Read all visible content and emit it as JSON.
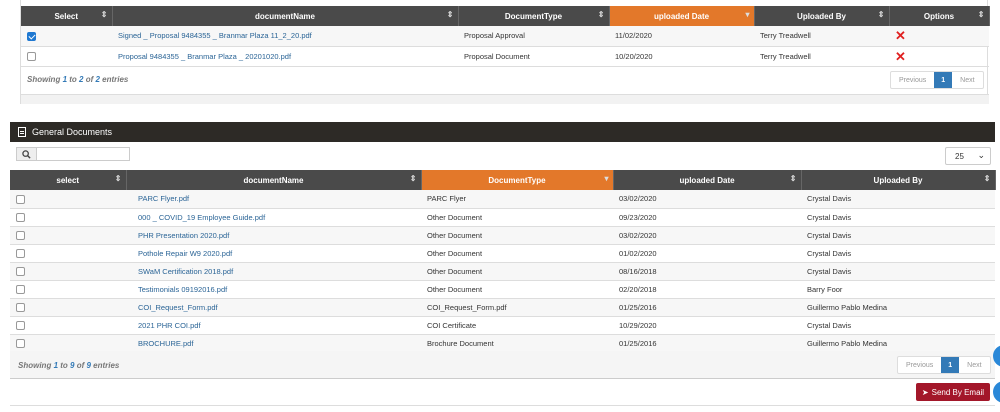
{
  "top_table": {
    "headers": [
      "Select",
      "documentName",
      "DocumentType",
      "uploaded Date",
      "Uploaded By",
      "Options"
    ],
    "rows": [
      {
        "checked": true,
        "name": "Signed _ Proposal 9484355 _ Branmar Plaza 11_2_20.pdf",
        "type": "Proposal Approval",
        "date": "11/02/2020",
        "by": "Terry Treadwell"
      },
      {
        "checked": false,
        "name": "Proposal 9484355 _ Branmar Plaza _ 20201020.pdf",
        "type": "Proposal Document",
        "date": "10/20/2020",
        "by": "Terry Treadwell"
      }
    ],
    "info_prefix": "Showing ",
    "info_from": "1",
    "info_to_word": " to ",
    "info_to": "2",
    "info_of_word": " of ",
    "info_total": "2",
    "info_suffix": " entries",
    "pager": {
      "prev": "Previous",
      "page": "1",
      "next": "Next"
    }
  },
  "general": {
    "title": "General Documents",
    "page_size": "25",
    "search_placeholder": "",
    "headers": [
      "select",
      "documentName",
      "DocumentType",
      "uploaded Date",
      "Uploaded By"
    ],
    "rows": [
      {
        "name": "PARC Flyer.pdf",
        "type": "PARC Flyer",
        "date": "03/02/2020",
        "by": "Crystal Davis"
      },
      {
        "name": "000 _ COVID_19 Employee Guide.pdf",
        "type": "Other Document",
        "date": "09/23/2020",
        "by": "Crystal Davis"
      },
      {
        "name": "PHR Presentation 2020.pdf",
        "type": "Other Document",
        "date": "03/02/2020",
        "by": "Crystal Davis"
      },
      {
        "name": "Pothole Repair W9 2020.pdf",
        "type": "Other Document",
        "date": "01/02/2020",
        "by": "Crystal Davis"
      },
      {
        "name": "SWaM Certification 2018.pdf",
        "type": "Other Document",
        "date": "08/16/2018",
        "by": "Crystal Davis"
      },
      {
        "name": "Testimonials 09192016.pdf",
        "type": "Other Document",
        "date": "02/20/2018",
        "by": "Barry Foor"
      },
      {
        "name": "COI_Request_Form.pdf",
        "type": "COI_Request_Form.pdf",
        "date": "01/25/2016",
        "by": "Guillermo Pablo Medina"
      },
      {
        "name": "2021 PHR COI.pdf",
        "type": "COI Certificate",
        "date": "10/29/2020",
        "by": "Crystal Davis"
      },
      {
        "name": "BROCHURE.pdf",
        "type": "Brochure Document",
        "date": "01/25/2016",
        "by": "Guillermo Pablo Medina"
      }
    ],
    "info_prefix": "Showing ",
    "info_from": "1",
    "info_to_word": " to ",
    "info_to": "9",
    "info_of_word": " of ",
    "info_total": "9",
    "info_suffix": " entries",
    "pager": {
      "prev": "Previous",
      "page": "1",
      "next": "Next"
    },
    "send_label": "Send By Email"
  },
  "colors": {
    "header_bg": "#4a4a4a",
    "active_sort": "#e3782a",
    "section_bar": "#2d2a26",
    "send_button": "#a3172a",
    "link": "#2a6496"
  }
}
